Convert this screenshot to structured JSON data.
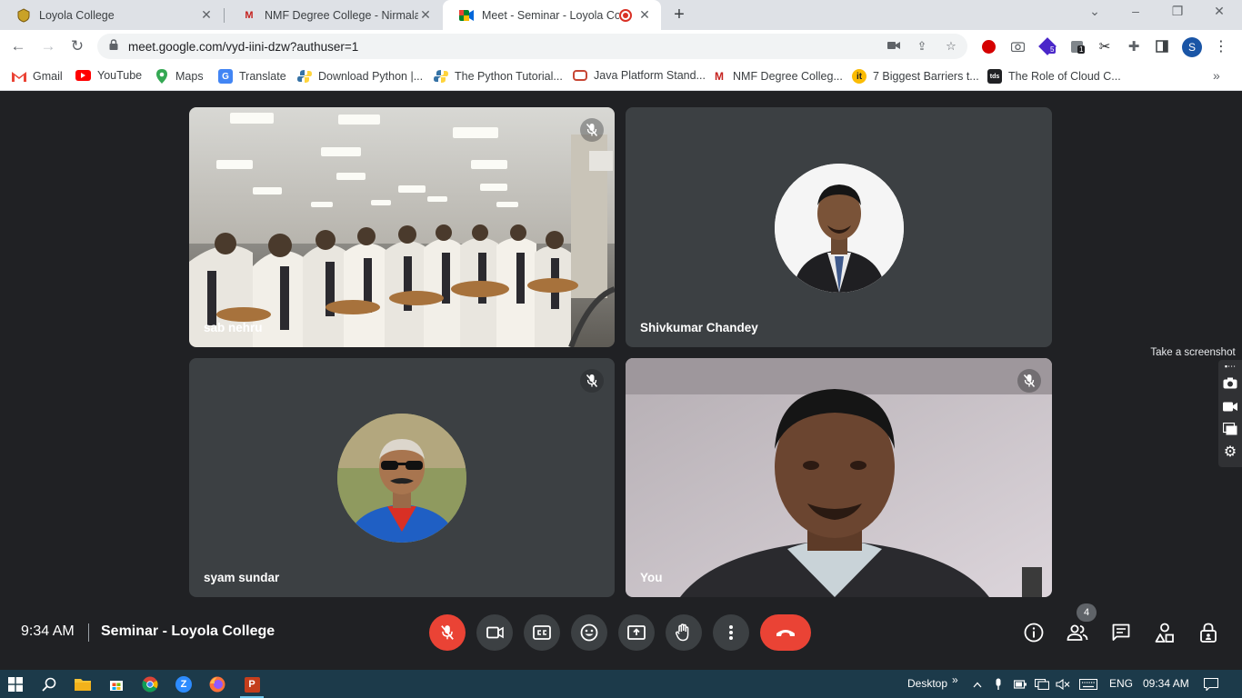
{
  "browser": {
    "tabs": [
      {
        "title": "Loyola College",
        "active": false
      },
      {
        "title": "NMF Degree College - Nirmala M",
        "active": false
      },
      {
        "title": "Meet - Seminar - Loyola Coll",
        "active": true
      }
    ],
    "url": "meet.google.com/vyd-iini-dzw?authuser=1",
    "profile_initial": "S",
    "extension_badges": {
      "ext_a": "5",
      "ext_b": "1"
    },
    "bookmarks": [
      {
        "label": "Gmail"
      },
      {
        "label": "YouTube"
      },
      {
        "label": "Maps"
      },
      {
        "label": "Translate"
      },
      {
        "label": "Download Python |..."
      },
      {
        "label": "The Python Tutorial..."
      },
      {
        "label": "Java Platform Stand..."
      },
      {
        "label": "NMF Degree Colleg..."
      },
      {
        "label": "7 Biggest Barriers t..."
      },
      {
        "label": "The Role of Cloud C..."
      }
    ]
  },
  "meet": {
    "participants": [
      {
        "name": "sab nehru",
        "muted": true
      },
      {
        "name": "Shivkumar Chandey",
        "muted": false
      },
      {
        "name": "syam sundar",
        "muted": true
      },
      {
        "name": "You",
        "muted": true
      }
    ],
    "time": "9:34 AM",
    "meeting_title": "Seminar - Loyola College",
    "people_count": "4"
  },
  "screenshot_tool": {
    "tooltip": "Take a screenshot"
  },
  "taskbar": {
    "desktop_label": "Desktop",
    "language": "ENG",
    "clock": "09:34 AM"
  },
  "colors": {
    "meet_bg": "#202124",
    "tile_bg": "#3c4043",
    "end_call": "#ea4335",
    "taskbar": "#1c3a4a"
  }
}
